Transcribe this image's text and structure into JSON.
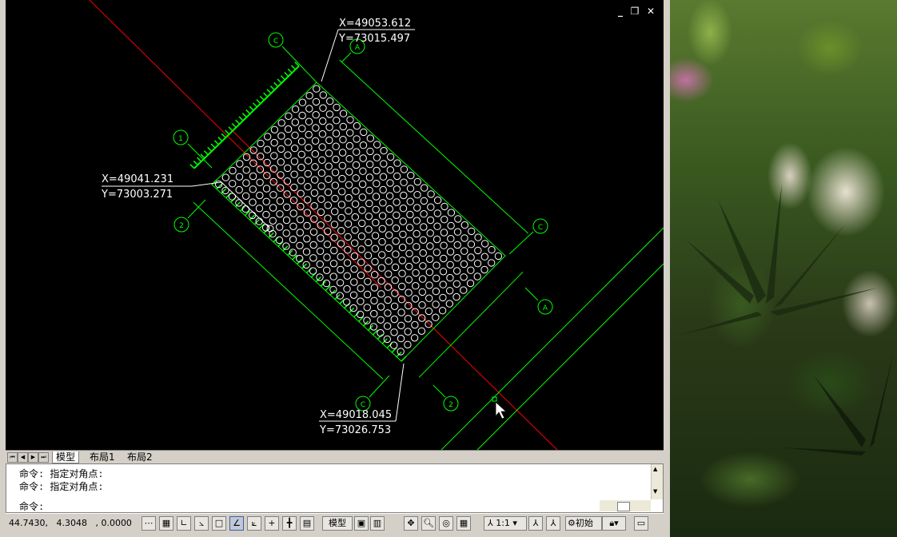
{
  "window": {
    "controls": [
      "_",
      "❐",
      "✕"
    ]
  },
  "drawing": {
    "callouts": [
      {
        "x": "X=49053.612",
        "y": "Y=73015.497"
      },
      {
        "x": "X=49041.231",
        "y": "Y=73003.271"
      },
      {
        "x": "X=49018.045",
        "y": "Y=73026.753"
      }
    ],
    "grid_axes": [
      "C",
      "A",
      "1",
      "2",
      "C",
      "A",
      "2"
    ]
  },
  "layout_tabs": [
    "模型",
    "布局1",
    "布局2"
  ],
  "command": {
    "history": [
      "命令: 指定对角点:",
      "命令: 指定对角点:"
    ],
    "prompt": "命令:"
  },
  "status": {
    "coords": "44.7430,   4.3048   , 0.0000",
    "model_label": "模型",
    "scale_label": "1:1",
    "workspace_label": "初始"
  },
  "colors": {
    "background": "#000000",
    "grid_line": "#00ff00",
    "center_line": "#ff0000",
    "circle": "#ffffff"
  }
}
